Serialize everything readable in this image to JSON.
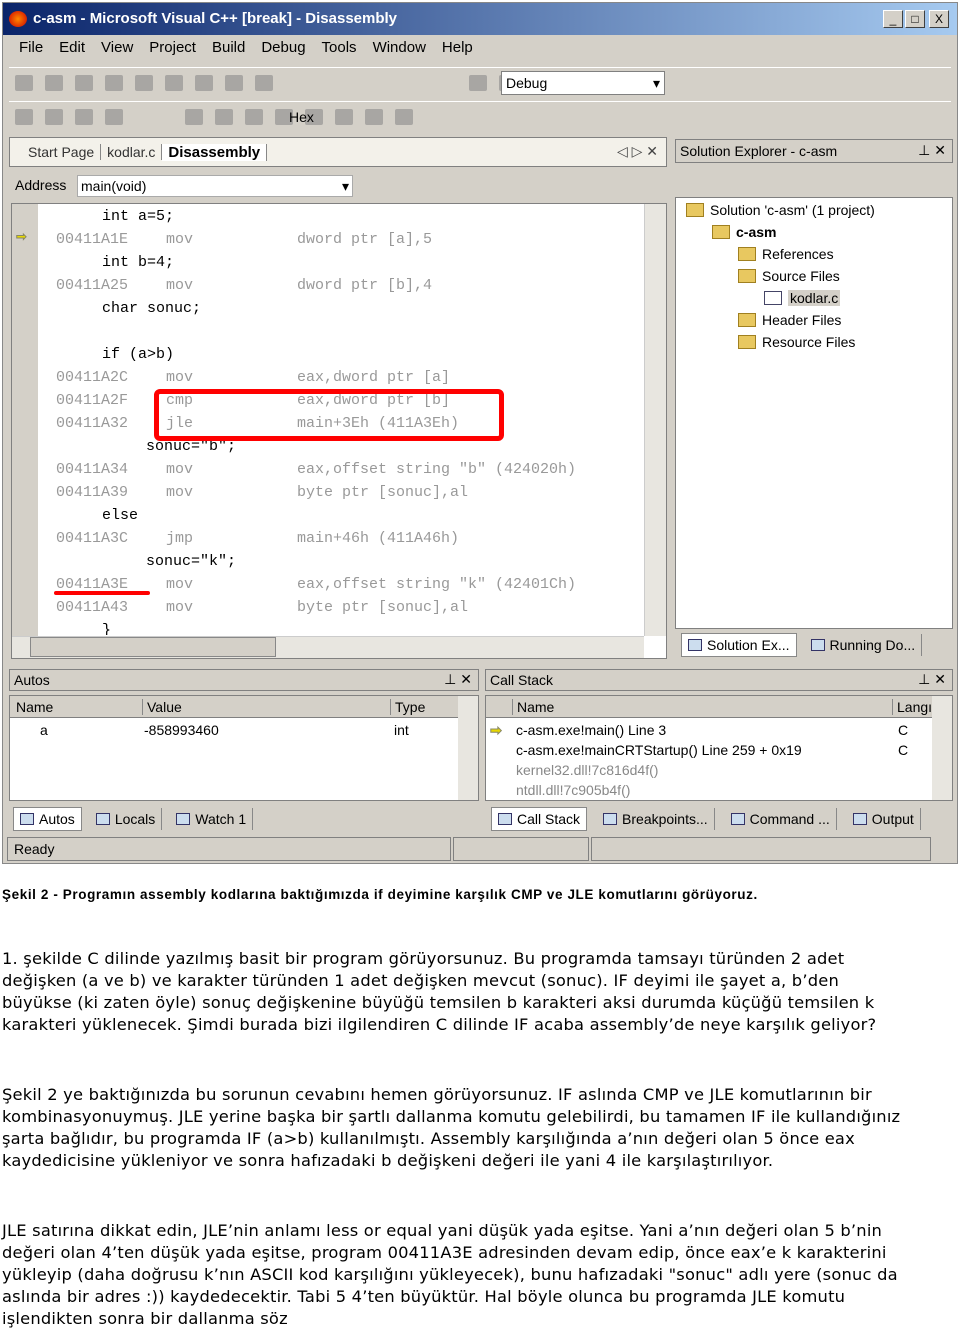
{
  "window": {
    "title": "c-asm - Microsoft Visual C++ [break] - Disassembly",
    "min": "_",
    "max": "□",
    "close": "X"
  },
  "menu": [
    "File",
    "Edit",
    "View",
    "Project",
    "Build",
    "Debug",
    "Tools",
    "Window",
    "Help"
  ],
  "toolbar": {
    "config": "Debug",
    "hex": "Hex"
  },
  "editor": {
    "tabs": [
      "Start Page",
      "kodlar.c",
      "Disassembly"
    ],
    "address_label": "Address",
    "address_value": "main(void)",
    "lines": [
      {
        "src": "int a=5;"
      },
      {
        "addr": "00411A1E",
        "op": "mov",
        "args": "dword ptr [a],5",
        "current": true
      },
      {
        "src": "int b=4;"
      },
      {
        "addr": "00411A25",
        "op": "mov",
        "args": "dword ptr [b],4"
      },
      {
        "src": "char sonuc;"
      },
      {
        "src": ""
      },
      {
        "src": "if (a>b)"
      },
      {
        "addr": "00411A2C",
        "op": "mov",
        "args": "eax,dword ptr [a]"
      },
      {
        "addr": "00411A2F",
        "op": "cmp",
        "args": "eax,dword ptr [b]"
      },
      {
        "addr": "00411A32",
        "op": "jle",
        "args": "main+3Eh (411A3Eh)"
      },
      {
        "src": "sonuc=\"b\";",
        "indent": true
      },
      {
        "addr": "00411A34",
        "op": "mov",
        "args": "eax,offset string \"b\" (424020h)"
      },
      {
        "addr": "00411A39",
        "op": "mov",
        "args": "byte ptr [sonuc],al"
      },
      {
        "src": "else"
      },
      {
        "addr": "00411A3C",
        "op": "jmp",
        "args": "main+46h (411A46h)"
      },
      {
        "src": "sonuc=\"k\";",
        "indent": true
      },
      {
        "addr": "00411A3E",
        "op": "mov",
        "args": "eax,offset string \"k\" (42401Ch)",
        "underline": true
      },
      {
        "addr": "00411A43",
        "op": "mov",
        "args": "byte ptr [sonuc],al"
      },
      {
        "src": "}"
      }
    ]
  },
  "solution": {
    "title": "Solution Explorer - c-asm",
    "items": [
      "Solution 'c-asm' (1 project)",
      "c-asm",
      "References",
      "Source Files",
      "kodlar.c",
      "Header Files",
      "Resource Files"
    ],
    "tabs": [
      "Solution Ex...",
      "Running Do..."
    ]
  },
  "autos": {
    "title": "Autos",
    "columns": [
      "Name",
      "Value",
      "Type"
    ],
    "rows": [
      [
        "a",
        "-858993460",
        "int"
      ]
    ],
    "tabs": [
      "Autos",
      "Locals",
      "Watch 1"
    ]
  },
  "callstack": {
    "title": "Call Stack",
    "columns": [
      "Name",
      "Langı"
    ],
    "rows": [
      [
        "c-asm.exe!main() Line 3",
        "C"
      ],
      [
        "c-asm.exe!mainCRTStartup() Line 259 + 0x19",
        "C"
      ],
      [
        "kernel32.dll!7c816d4f()",
        ""
      ],
      [
        "ntdll.dll!7c905b4f()",
        ""
      ]
    ],
    "tabs": [
      "Call Stack",
      "Breakpoints...",
      "Command ...",
      "Output"
    ]
  },
  "status": "Ready",
  "highlight_color": "#ff0000",
  "caption": "Şekil 2 - Programın assembly kodlarına baktığımızda if deyimine karşılık CMP ve JLE komutlarını görüyoruz.",
  "paragraphs": [
    "1. şekilde C dilinde yazılmış basit bir program görüyorsunuz. Bu programda tamsayı türünden 2 adet değişken (a ve b) ve karakter türünden 1 adet değişken mevcut (sonuc). IF deyimi ile şayet a, b’den büyükse (ki zaten öyle) sonuç değişkenine büyüğü temsilen b karakteri aksi durumda küçüğü temsilen k karakteri yüklenecek. Şimdi burada bizi ilgilendiren C dilinde IF acaba assembly’de neye karşılık geliyor?",
    "Şekil 2 ye baktığınızda bu sorunun cevabını hemen görüyorsunuz. IF aslında CMP ve JLE komutlarının bir kombinasyonuymuş. JLE yerine başka bir şartlı dallanma komutu gelebilirdi, bu tamamen IF ile kullandığınız şarta bağlıdır, bu programda IF (a>b) kullanılmıştı. Assembly karşılığında a’nın değeri olan 5 önce eax kaydedicisine yükleniyor ve sonra hafızadaki b değişkeni değeri ile yani 4 ile karşılaştırılıyor.",
    "JLE satırına dikkat edin, JLE’nin anlamı less or equal yani düşük yada eşitse. Yani a’nın değeri olan 5 b’nin değeri olan 4’ten düşük yada eşitse, program 00411A3E adresinden devam edip, önce eax’e k karakterini yükleyip (daha doğrusu k’nın ASCII kod karşılığını yükleyecek), bunu hafızadaki \"sonuc\" adlı yere (sonuc da aslında bir adres :)) kaydedecektir. Tabi 5 4’ten büyüktür. Hal böyle olunca bu programda JLE komutu işlendikten sonra bir dallanma söz"
  ]
}
